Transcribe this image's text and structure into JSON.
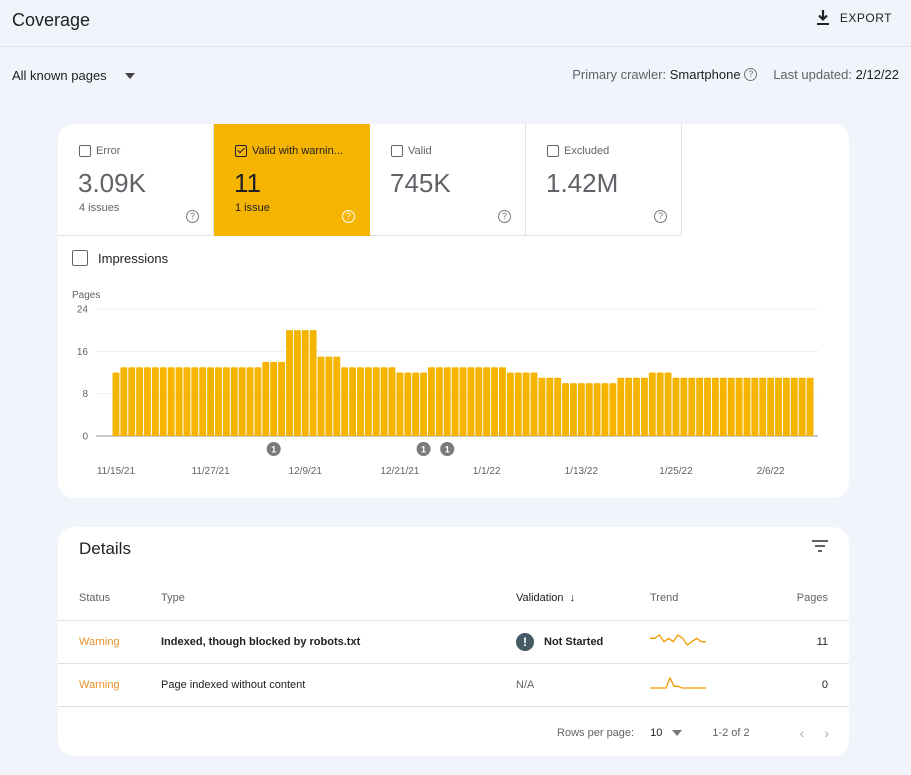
{
  "header": {
    "title": "Coverage",
    "export_label": "EXPORT",
    "export_icon": "download-icon"
  },
  "filters": {
    "page_filter": "All known pages",
    "crawler_label": "Primary crawler:",
    "crawler_value": "Smartphone",
    "updated_label": "Last updated:",
    "updated_value": "2/12/22"
  },
  "tiles": [
    {
      "label": "Error",
      "value": "3.09K",
      "sub": "4 issues",
      "checked": false
    },
    {
      "label": "Valid with warnin...",
      "value": "11",
      "sub": "1 issue",
      "checked": true
    },
    {
      "label": "Valid",
      "value": "745K",
      "sub": "",
      "checked": false
    },
    {
      "label": "Excluded",
      "value": "1.42M",
      "sub": "",
      "checked": false
    }
  ],
  "impressions_label": "Impressions",
  "colors": {
    "accent": "#f5b400",
    "warning_text": "#e8912b",
    "background": "#f1f4fb",
    "annotation": "#7a7a7a"
  },
  "chart_data": {
    "type": "bar",
    "title": "",
    "ylabel": "Pages",
    "xlabel": "",
    "ylim": [
      0,
      24
    ],
    "yticks": [
      0,
      8,
      16,
      24
    ],
    "grid": true,
    "start_date": "11/15/21",
    "xtick_labels": [
      "11/15/21",
      "11/27/21",
      "12/9/21",
      "12/21/21",
      "1/1/22",
      "1/13/22",
      "1/25/22",
      "2/6/22"
    ],
    "xtick_indices": [
      0,
      12,
      24,
      36,
      47,
      59,
      71,
      83
    ],
    "values": [
      12,
      13,
      13,
      13,
      13,
      13,
      13,
      13,
      13,
      13,
      13,
      13,
      13,
      13,
      13,
      13,
      13,
      13,
      13,
      14,
      14,
      14,
      20,
      20,
      20,
      20,
      15,
      15,
      15,
      13,
      13,
      13,
      13,
      13,
      13,
      13,
      12,
      12,
      12,
      12,
      13,
      13,
      13,
      13,
      13,
      13,
      13,
      13,
      13,
      13,
      12,
      12,
      12,
      12,
      11,
      11,
      11,
      10,
      10,
      10,
      10,
      10,
      10,
      10,
      11,
      11,
      11,
      11,
      12,
      12,
      12,
      11,
      11,
      11,
      11,
      11,
      11,
      11,
      11,
      11,
      11,
      11,
      11,
      11,
      11,
      11,
      11,
      11,
      11
    ],
    "annotations": [
      {
        "index": 20,
        "label": "1"
      },
      {
        "index": 39,
        "label": "1"
      },
      {
        "index": 42,
        "label": "1"
      }
    ]
  },
  "details": {
    "title": "Details",
    "filter_icon": "filter-icon",
    "columns": [
      "Status",
      "Type",
      "Validation",
      "Trend",
      "Pages"
    ],
    "rows": [
      {
        "status": "Warning",
        "type": "Indexed, though blocked by robots.txt",
        "validation": "Not Started",
        "validation_icon": "exclamation-icon",
        "pages": "11",
        "trend": [
          12,
          12,
          13,
          11,
          12,
          11,
          13,
          12,
          10,
          11,
          12,
          11,
          11
        ]
      },
      {
        "status": "Warning",
        "type": "Page indexed without content",
        "validation": "N/A",
        "validation_icon": "",
        "pages": "0",
        "trend": [
          0,
          0,
          0,
          0,
          0,
          6,
          1,
          1,
          0,
          0,
          0,
          0,
          0,
          0,
          0
        ]
      }
    ],
    "pagination": {
      "rows_per_page_label": "Rows per page:",
      "rows_per_page_value": "10",
      "range": "1-2 of 2"
    }
  }
}
